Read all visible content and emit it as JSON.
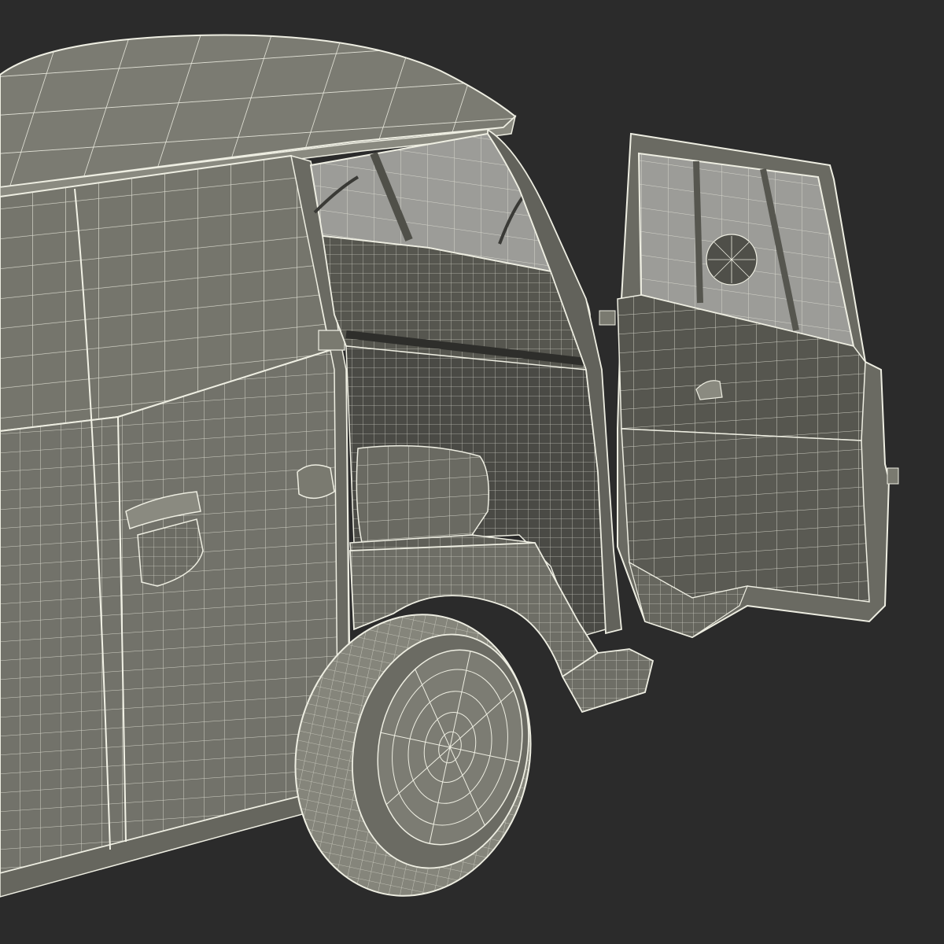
{
  "scene": {
    "subject": "van-wireframe-render",
    "door_state": "open"
  },
  "colors": {
    "background": "#2b2b2b",
    "body_fill": "#76766c",
    "body_shade": "#5d5d55",
    "interior_fill": "#4d4d47",
    "wire": "#e8e8dc",
    "glass": "#9c9c98",
    "tire": "#8a8a80"
  }
}
